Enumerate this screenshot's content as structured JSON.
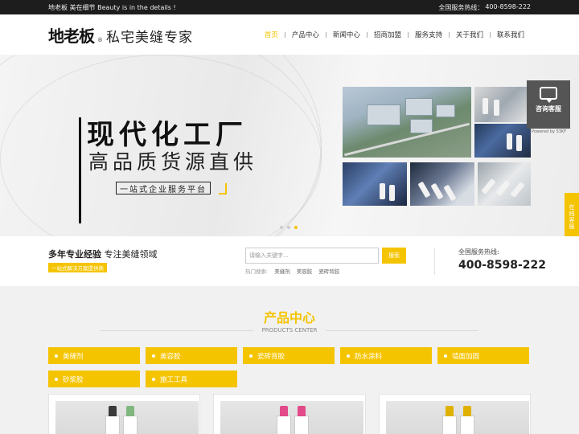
{
  "topbar": {
    "tagline": "地老板 美在细节 Beauty is in the details !",
    "hotline_label": "全国服务热线：",
    "hotline_number": "400-8598-222"
  },
  "header": {
    "brand": "地老板",
    "slogan": "私宅美缝专家",
    "nav": [
      "首页",
      "产品中心",
      "新闻中心",
      "招商加盟",
      "服务支持",
      "关于我们",
      "联系我们"
    ],
    "active_nav": "首页"
  },
  "banner": {
    "headline": "现代化工厂",
    "subheadline": "高品质货源直供",
    "pill": "一站式企业服务平台",
    "slides": 3,
    "active_slide": 3
  },
  "chat_widget": {
    "label": "咨询客服",
    "powered": "Powered by 53KF"
  },
  "side_tab": {
    "label": "在线客服"
  },
  "info_strip": {
    "lead_bold": "多年专业经验",
    "lead_rest": "专注美缝领域",
    "tag": "一站式解决方案提供商",
    "search_placeholder": "请输入关键字...",
    "search_button": "搜索",
    "hot_label": "热门搜索:",
    "hot_words": [
      "美缝剂",
      "美容胶",
      "瓷砖背胶"
    ],
    "hotline_label": "全国服务热线:",
    "hotline_number": "400-8598-222"
  },
  "products": {
    "title": "产品中心",
    "subtitle": "PRODUCTS CENTER",
    "categories": [
      "美缝剂",
      "美容胶",
      "瓷砖背胶",
      "防水涂料",
      "墙面加固",
      "砂浆胶",
      "施工工具"
    ]
  },
  "colors": {
    "accent": "#f5c400",
    "topbar": "#1d1d1d"
  }
}
